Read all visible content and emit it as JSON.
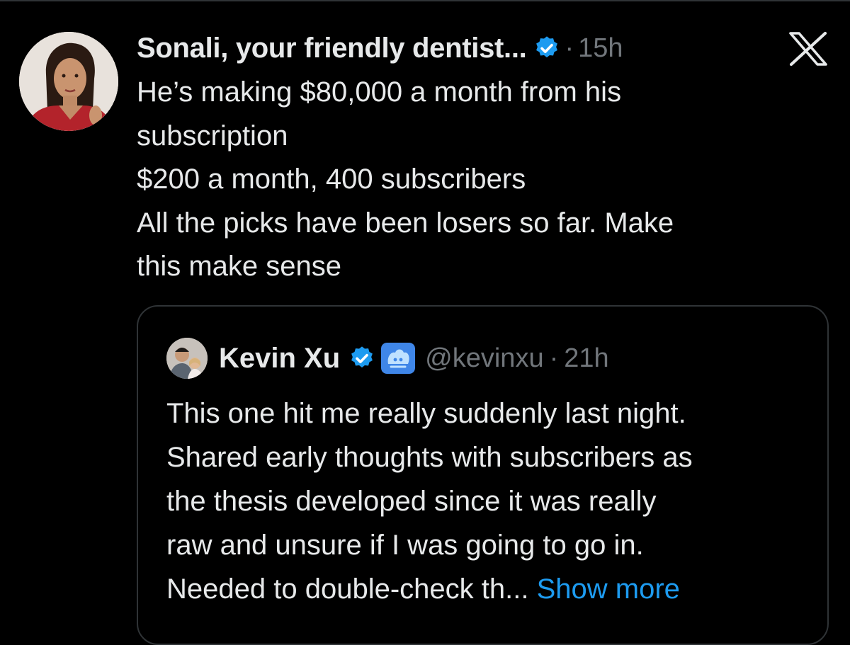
{
  "tweet": {
    "author_name": "Sonali, your friendly dentist...",
    "separator": "·",
    "time": "15h",
    "verified_icon": "verified-badge-icon",
    "body_lines": [
      "He’s making $80,000 a month from his",
      "subscription",
      "$200 a month, 400 subscribers",
      "All the picks have been losers so far. Make",
      "this make sense"
    ]
  },
  "quoted_tweet": {
    "author_name": "Kevin Xu",
    "handle": "@kevinxu",
    "separator": "·",
    "time": "21h",
    "verified_icon": "verified-badge-icon",
    "affiliate_icon": "affiliate-badge-icon",
    "body_lines": [
      "This one hit me really suddenly last night.",
      "Shared early thoughts with subscribers as",
      "the thesis developed since it was really",
      "raw and unsure if I was going to go in.",
      "Needed to double-check th..."
    ],
    "show_more_label": "Show more"
  },
  "brand": {
    "logo_icon": "x-logo-icon"
  },
  "colors": {
    "background": "#000000",
    "text_primary": "#e7e9ea",
    "text_secondary": "#71767b",
    "accent": "#1d9bf0",
    "border": "#2f3336"
  }
}
